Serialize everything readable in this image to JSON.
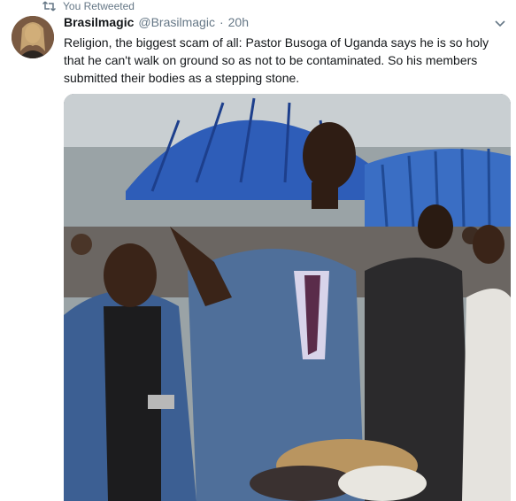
{
  "context": {
    "label": "You Retweeted",
    "icon": "retweet-icon",
    "color": "#657786"
  },
  "tweet": {
    "author": {
      "display_name": "Brasilmagic",
      "handle": "@Brasilmagic",
      "avatar_icon": "avatar-photo"
    },
    "separator": "·",
    "timestamp": "20h",
    "text": "Religion, the biggest scam of all: Pastor Busoga of Uganda says he is so holy that he can't walk on ground so as not to be contaminated. So his members submitted their bodies as a stepping stone.",
    "menu_icon": "chevron-down-icon",
    "media": {
      "type": "photo"
    }
  },
  "colors": {
    "text": "#14171a",
    "secondary": "#657786",
    "background": "#ffffff"
  }
}
